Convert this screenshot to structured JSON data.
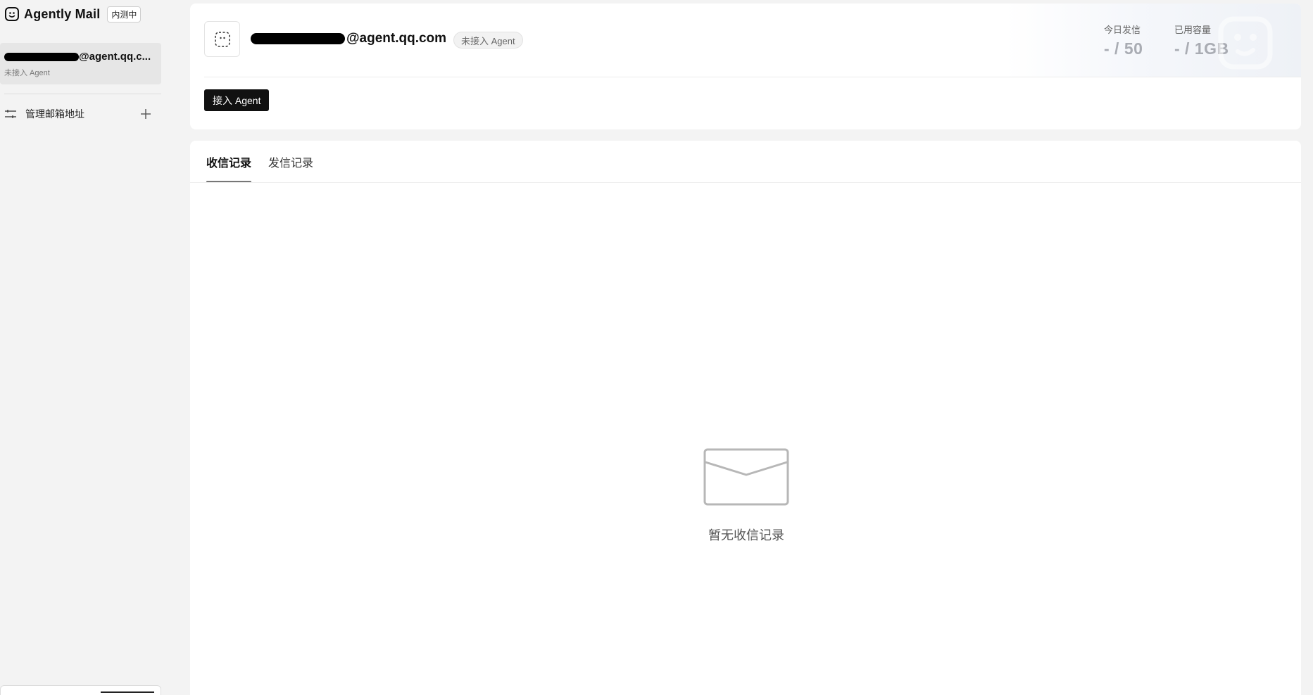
{
  "brand": {
    "name": "Agently Mail",
    "badge": "内测中",
    "logo_icon": "smiley-face-icon"
  },
  "sidebar": {
    "mailbox": {
      "address_suffix": "@agent.qq.c...",
      "status": "未接入 Agent"
    },
    "manage": {
      "label": "管理邮箱地址",
      "icon": "sliders-icon",
      "add_icon": "plus-icon"
    }
  },
  "header": {
    "address_suffix": "@agent.qq.com",
    "status_pill": "未接入 Agent",
    "avatar_icon": "dashed-face-icon",
    "stats": [
      {
        "label": "今日发信",
        "value": "- / 50"
      },
      {
        "label": "已用容量",
        "value": "- / 1GB"
      }
    ],
    "connect_button": "接入 Agent"
  },
  "records": {
    "tabs": [
      {
        "label": "收信记录",
        "active": true
      },
      {
        "label": "发信记录",
        "active": false
      }
    ],
    "empty_icon": "envelope-icon",
    "empty_text": "暂无收信记录"
  },
  "colors": {
    "primary_button": "#111111",
    "stat_value": "#a9acb3",
    "sidebar_selected": "#e6e6e6",
    "page_background": "#f3f3f3"
  }
}
